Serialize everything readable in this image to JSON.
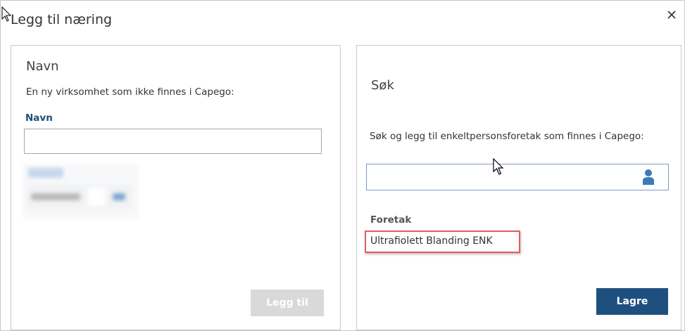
{
  "dialog": {
    "title": "Legg til næring",
    "close_icon": "close-icon"
  },
  "left_panel": {
    "heading": "Navn",
    "description": "En ny virksomhet som ikke finnes i Capego:",
    "name_label": "Navn",
    "name_value": "",
    "add_button_label": "Legg til"
  },
  "right_panel": {
    "heading": "Søk",
    "description": "Søk og legg til enkeltpersonsforetak som finnes i Capego:",
    "search_value": "",
    "search_icon": "person-icon",
    "foretak_label": "Foretak",
    "foretak_items": [
      "Ultrafiolett Blanding ENK"
    ],
    "save_button_label": "Lagre"
  },
  "colors": {
    "primary": "#1e507f",
    "label_blue": "#1f4e79",
    "disabled": "#d9d9d9",
    "highlight": "#e25d5d"
  }
}
